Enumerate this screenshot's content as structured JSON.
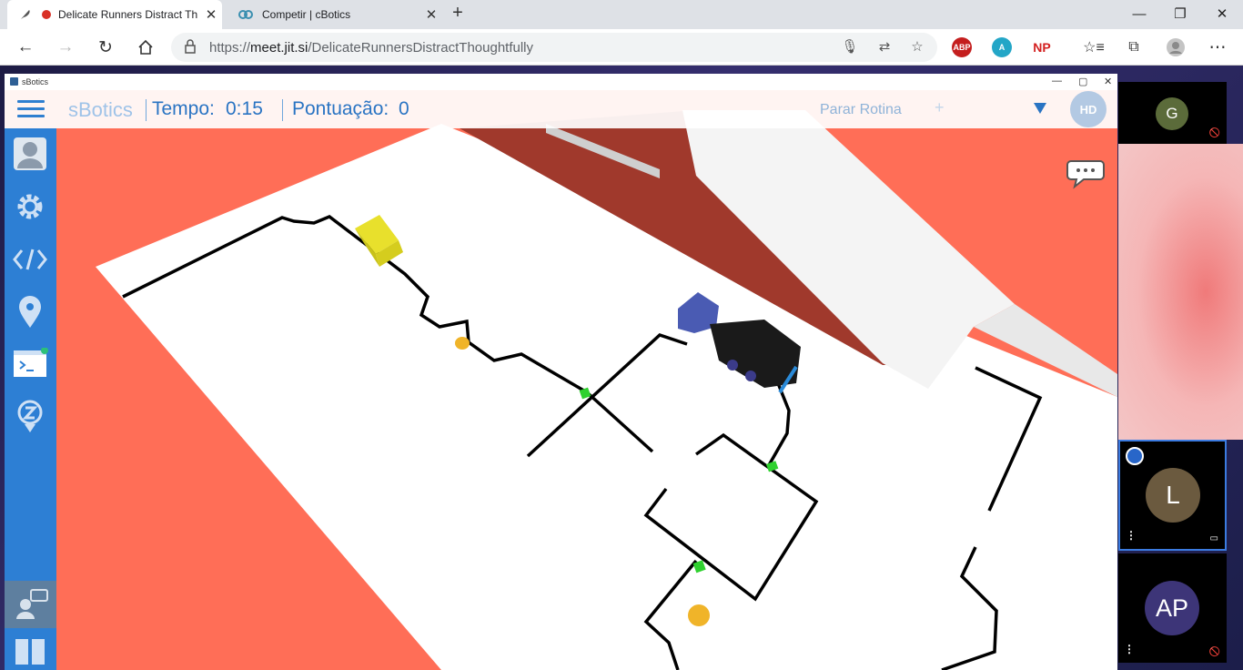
{
  "browser": {
    "tabs": [
      {
        "title": "Delicate Runners Distract Th",
        "active": true,
        "favicon": "feather-icon",
        "recording": true
      },
      {
        "title": "Competir | cBotics",
        "active": false,
        "favicon": "cbotics-icon"
      }
    ],
    "new_tab_label": "+",
    "url_prefix": "https://",
    "url_host": "meet.jit.si",
    "url_path": "/DelicateRunnersDistractThoughtfully",
    "extensions": [
      "ABP",
      "NP"
    ]
  },
  "app": {
    "window_title": "sBotics",
    "brand": "sBotics",
    "tempo_label": "Tempo:",
    "tempo_value": "0:15",
    "pontuacao_label": "Pontuação:",
    "pontuacao_value": "0",
    "parar_rotina": "Parar Rotina",
    "plus_label": "+",
    "user_initials": "HD",
    "sidebar_items": [
      "profile-icon",
      "gear-icon",
      "code-icon",
      "location-pin-icon",
      "terminal-icon",
      "zoom-icon",
      "support-chat-icon",
      "book-icon"
    ]
  },
  "participants": [
    {
      "initials": "G",
      "color": "#5b6b3a"
    },
    {
      "initials": "L",
      "color": "#6b5a3f"
    },
    {
      "initials": "AP",
      "color": "#3d3578"
    }
  ],
  "colors": {
    "accent": "#2a74c3",
    "sidebar": "#2d7fd4",
    "arena_background": "#ff6e57",
    "field": "#ffffff",
    "line": "#000000"
  }
}
